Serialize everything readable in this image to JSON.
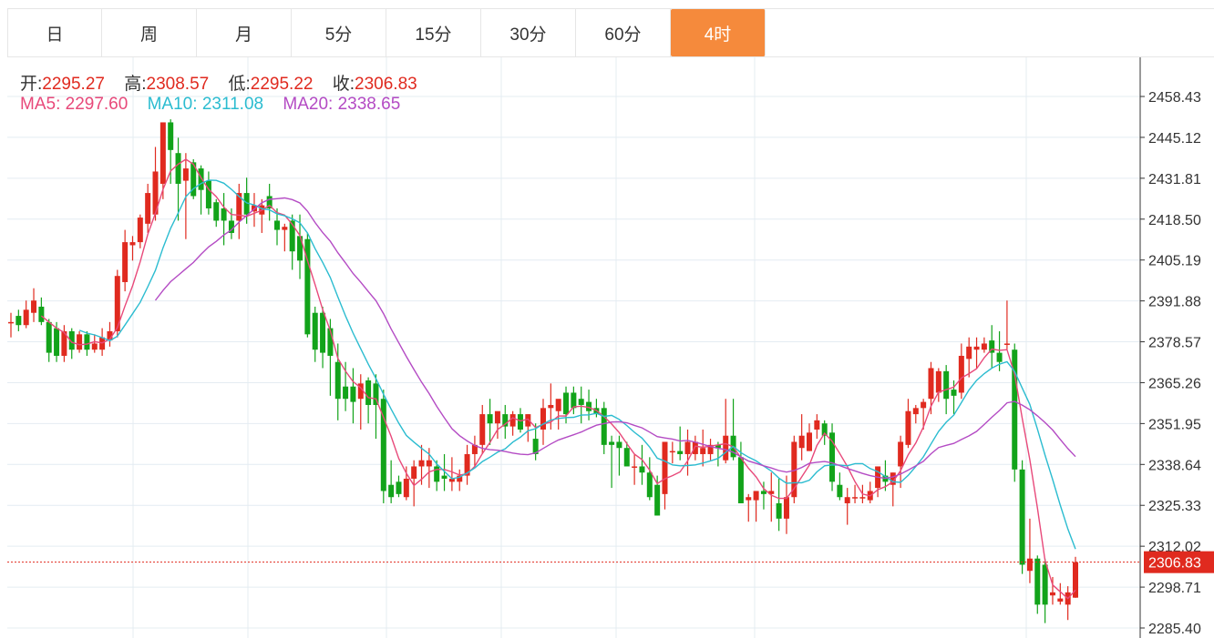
{
  "tabs": [
    {
      "label": "日",
      "active": false
    },
    {
      "label": "周",
      "active": false
    },
    {
      "label": "月",
      "active": false
    },
    {
      "label": "5分",
      "active": false
    },
    {
      "label": "15分",
      "active": false
    },
    {
      "label": "30分",
      "active": false
    },
    {
      "label": "60分",
      "active": false
    },
    {
      "label": "4时",
      "active": true
    }
  ],
  "ohlc": {
    "open_label": "开:",
    "open": "2295.27",
    "high_label": "高:",
    "high": "2308.57",
    "low_label": "低:",
    "low": "2295.22",
    "close_label": "收:",
    "close": "2306.83"
  },
  "ma": {
    "ma5_label": "MA5:",
    "ma5": "2297.60",
    "ma10_label": "MA10:",
    "ma10": "2311.08",
    "ma20_label": "MA20:",
    "ma20": "2338.65"
  },
  "colors": {
    "up": "#e02a1f",
    "down": "#12a31a",
    "ma5": "#e8497a",
    "ma10": "#2bbcd0",
    "ma20": "#b44bc4",
    "active_tab": "#f58a3c",
    "grid": "#e4ecf2"
  },
  "chart_data": {
    "type": "candlestick",
    "y_ticks": [
      "2458.43",
      "2445.12",
      "2431.81",
      "2418.50",
      "2405.19",
      "2391.88",
      "2378.57",
      "2365.26",
      "2351.95",
      "2338.64",
      "2325.33",
      "2312.02",
      "2298.71",
      "2285.40"
    ],
    "ylim": [
      2285.4,
      2458.43
    ],
    "last_price": "2306.83",
    "candles": [
      [
        2385,
        2388,
        2380,
        2385
      ],
      [
        2387,
        2389,
        2382,
        2384
      ],
      [
        2384,
        2392,
        2383,
        2389
      ],
      [
        2388,
        2396,
        2385,
        2392
      ],
      [
        2390,
        2393,
        2384,
        2385
      ],
      [
        2385,
        2386,
        2372,
        2375
      ],
      [
        2383,
        2385,
        2372,
        2374
      ],
      [
        2374,
        2384,
        2372,
        2382
      ],
      [
        2382,
        2383,
        2373,
        2376
      ],
      [
        2376,
        2382,
        2375,
        2381
      ],
      [
        2381,
        2382,
        2374,
        2376
      ],
      [
        2376,
        2381,
        2375,
        2378
      ],
      [
        2376,
        2383,
        2374,
        2380
      ],
      [
        2379,
        2385,
        2377,
        2382
      ],
      [
        2382,
        2402,
        2380,
        2400
      ],
      [
        2398,
        2415,
        2395,
        2411
      ],
      [
        2410,
        2413,
        2405,
        2411
      ],
      [
        2411,
        2420,
        2409,
        2419
      ],
      [
        2417,
        2430,
        2414,
        2427
      ],
      [
        2420,
        2442,
        2418,
        2434
      ],
      [
        2430,
        2450,
        2425,
        2450
      ],
      [
        2450,
        2451,
        2430,
        2441
      ],
      [
        2440,
        2445,
        2418,
        2430
      ],
      [
        2431,
        2440,
        2412,
        2435
      ],
      [
        2437,
        2438,
        2425,
        2426
      ],
      [
        2435,
        2436,
        2420,
        2428
      ],
      [
        2431,
        2434,
        2420,
        2422
      ],
      [
        2424,
        2425,
        2416,
        2418
      ],
      [
        2422,
        2427,
        2410,
        2418
      ],
      [
        2418,
        2422,
        2412,
        2414
      ],
      [
        2418,
        2430,
        2412,
        2427
      ],
      [
        2427,
        2432,
        2417,
        2420
      ],
      [
        2421,
        2427,
        2416,
        2423
      ],
      [
        2420,
        2425,
        2414,
        2423
      ],
      [
        2426,
        2430,
        2418,
        2422
      ],
      [
        2418,
        2422,
        2410,
        2415
      ],
      [
        2415,
        2417,
        2408,
        2416
      ],
      [
        2418,
        2420,
        2402,
        2408
      ],
      [
        2413,
        2420,
        2399,
        2405
      ],
      [
        2412,
        2414,
        2380,
        2381
      ],
      [
        2388,
        2390,
        2372,
        2376
      ],
      [
        2388,
        2390,
        2370,
        2375
      ],
      [
        2383,
        2386,
        2361,
        2374
      ],
      [
        2372,
        2378,
        2353,
        2360
      ],
      [
        2364,
        2372,
        2356,
        2360
      ],
      [
        2364,
        2370,
        2352,
        2359
      ],
      [
        2360,
        2368,
        2350,
        2365
      ],
      [
        2366,
        2367,
        2352,
        2358
      ],
      [
        2365,
        2368,
        2347,
        2358
      ],
      [
        2360,
        2363,
        2326,
        2330
      ],
      [
        2332,
        2340,
        2326,
        2328
      ],
      [
        2333,
        2335,
        2328,
        2329
      ],
      [
        2328,
        2338,
        2327,
        2334
      ],
      [
        2334,
        2340,
        2325,
        2338
      ],
      [
        2338,
        2345,
        2332,
        2340
      ],
      [
        2338,
        2344,
        2331,
        2340
      ],
      [
        2338,
        2340,
        2330,
        2333
      ],
      [
        2335,
        2342,
        2330,
        2334
      ],
      [
        2333,
        2341,
        2330,
        2334
      ],
      [
        2333,
        2337,
        2330,
        2335
      ],
      [
        2335,
        2345,
        2332,
        2342
      ],
      [
        2342,
        2348,
        2338,
        2345
      ],
      [
        2345,
        2358,
        2342,
        2355
      ],
      [
        2355,
        2360,
        2345,
        2352
      ],
      [
        2352,
        2355,
        2347,
        2356
      ],
      [
        2355,
        2358,
        2347,
        2351
      ],
      [
        2351,
        2356,
        2348,
        2355
      ],
      [
        2355,
        2357,
        2349,
        2350
      ],
      [
        2351,
        2355,
        2346,
        2355
      ],
      [
        2347,
        2352,
        2340,
        2342
      ],
      [
        2350,
        2360,
        2345,
        2357
      ],
      [
        2357,
        2365,
        2350,
        2358
      ],
      [
        2356,
        2359,
        2350,
        2360
      ],
      [
        2362,
        2364,
        2352,
        2355
      ],
      [
        2362,
        2364,
        2355,
        2357
      ],
      [
        2360,
        2364,
        2352,
        2358
      ],
      [
        2359,
        2363,
        2353,
        2356
      ],
      [
        2357,
        2360,
        2354,
        2355
      ],
      [
        2357,
        2359,
        2342,
        2345
      ],
      [
        2346,
        2348,
        2331,
        2345
      ],
      [
        2346,
        2348,
        2335,
        2344
      ],
      [
        2344,
        2346,
        2340,
        2338
      ],
      [
        2338,
        2342,
        2332,
        2338
      ],
      [
        2338,
        2345,
        2332,
        2336
      ],
      [
        2336,
        2341,
        2327,
        2328
      ],
      [
        2332,
        2335,
        2322,
        2322
      ],
      [
        2329,
        2346,
        2324,
        2346
      ],
      [
        2343,
        2346,
        2339,
        2343
      ],
      [
        2343,
        2351,
        2340,
        2342
      ],
      [
        2342,
        2350,
        2335,
        2346
      ],
      [
        2342,
        2348,
        2340,
        2346
      ],
      [
        2342,
        2350,
        2338,
        2344
      ],
      [
        2342,
        2347,
        2340,
        2345
      ],
      [
        2345,
        2346,
        2338,
        2344
      ],
      [
        2340,
        2360,
        2339,
        2348
      ],
      [
        2348,
        2360,
        2340,
        2341
      ],
      [
        2341,
        2346,
        2326,
        2326
      ],
      [
        2327,
        2329,
        2320,
        2328
      ],
      [
        2327,
        2330,
        2320,
        2330
      ],
      [
        2330,
        2333,
        2324,
        2329
      ],
      [
        2329,
        2336,
        2320,
        2330
      ],
      [
        2326,
        2334,
        2317,
        2321
      ],
      [
        2321,
        2335,
        2316,
        2328
      ],
      [
        2328,
        2348,
        2326,
        2346
      ],
      [
        2344,
        2355,
        2340,
        2348
      ],
      [
        2343,
        2352,
        2343,
        2349
      ],
      [
        2350,
        2355,
        2347,
        2353
      ],
      [
        2352,
        2353,
        2345,
        2348
      ],
      [
        2349,
        2352,
        2330,
        2333
      ],
      [
        2332,
        2336,
        2327,
        2328
      ],
      [
        2326,
        2331,
        2319,
        2328
      ],
      [
        2328,
        2332,
        2326,
        2328
      ],
      [
        2328,
        2332,
        2326,
        2328
      ],
      [
        2327,
        2333,
        2326,
        2330
      ],
      [
        2331,
        2338,
        2328,
        2338
      ],
      [
        2335,
        2340,
        2330,
        2333
      ],
      [
        2332,
        2336,
        2325,
        2336
      ],
      [
        2338,
        2348,
        2331,
        2346
      ],
      [
        2345,
        2360,
        2344,
        2356
      ],
      [
        2355,
        2358,
        2352,
        2357
      ],
      [
        2357,
        2360,
        2350,
        2359
      ],
      [
        2360,
        2372,
        2355,
        2370
      ],
      [
        2362,
        2370,
        2359,
        2369
      ],
      [
        2369,
        2371,
        2355,
        2360
      ],
      [
        2363,
        2366,
        2355,
        2361
      ],
      [
        2362,
        2378,
        2360,
        2374
      ],
      [
        2373,
        2380,
        2367,
        2377
      ],
      [
        2376,
        2380,
        2370,
        2377
      ],
      [
        2376,
        2380,
        2375,
        2378
      ],
      [
        2379,
        2384,
        2370,
        2375
      ],
      [
        2375,
        2382,
        2369,
        2372
      ],
      [
        2378,
        2392,
        2376,
        2378
      ],
      [
        2376,
        2378,
        2333,
        2337
      ],
      [
        2337,
        2340,
        2303,
        2306
      ],
      [
        2304,
        2321,
        2300,
        2308
      ],
      [
        2308,
        2309,
        2290,
        2293
      ],
      [
        2306,
        2308,
        2287,
        2293
      ],
      [
        2296,
        2302,
        2293,
        2297
      ],
      [
        2294,
        2300,
        2293,
        2295
      ],
      [
        2293,
        2299,
        2288,
        2297
      ],
      [
        2295.27,
        2308.57,
        2295.22,
        2306.83
      ]
    ]
  }
}
